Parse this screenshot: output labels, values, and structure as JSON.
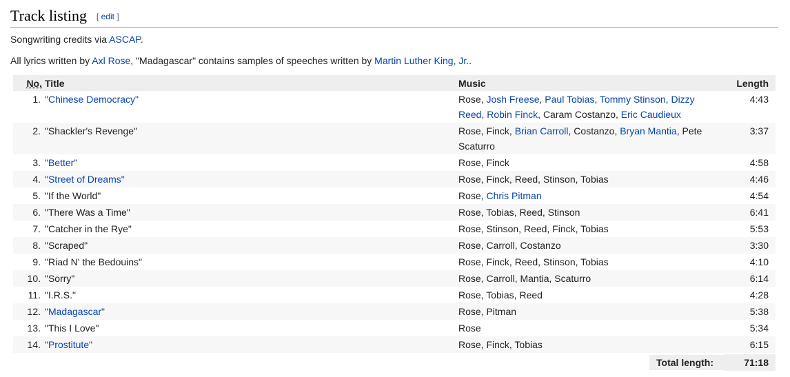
{
  "section": {
    "title": "Track listing",
    "edit_open": "[",
    "edit_label": "edit",
    "edit_close": "]"
  },
  "credits": {
    "prefix": "Songwriting credits via ",
    "link": "ASCAP",
    "suffix": "."
  },
  "lyrics": {
    "prefix": "All lyrics written by ",
    "author_link": "Axl Rose",
    "middle": ", \"Madagascar\" contains samples of speeches written by ",
    "speech_link": "Martin Luther King, Jr.",
    "suffix": "."
  },
  "table": {
    "headers": {
      "no": "No.",
      "title": "Title",
      "music": "Music",
      "length": "Length"
    },
    "rows": [
      {
        "no": "1.",
        "title": "\"Chinese Democracy\"",
        "title_link": true,
        "length": "4:43",
        "music": [
          {
            "t": "Rose, "
          },
          {
            "t": "Josh Freese",
            "link": true
          },
          {
            "t": ", "
          },
          {
            "t": "Paul Tobias",
            "link": true
          },
          {
            "t": ", "
          },
          {
            "t": "Tommy Stinson",
            "link": true
          },
          {
            "t": ", "
          },
          {
            "t": "Dizzy Reed",
            "link": true
          },
          {
            "t": ", "
          },
          {
            "t": "Robin Finck",
            "link": true
          },
          {
            "t": ", Caram Costanzo, "
          },
          {
            "t": "Eric Caudieux",
            "link": true
          }
        ]
      },
      {
        "no": "2.",
        "title": "\"Shackler's Revenge\"",
        "title_link": false,
        "length": "3:37",
        "music": [
          {
            "t": "Rose, Finck, "
          },
          {
            "t": "Brian Carroll",
            "link": true
          },
          {
            "t": ", Costanzo, "
          },
          {
            "t": "Bryan Mantia",
            "link": true
          },
          {
            "t": ", Pete Scaturro"
          }
        ]
      },
      {
        "no": "3.",
        "title": "\"Better\"",
        "title_link": true,
        "length": "4:58",
        "music": [
          {
            "t": "Rose, Finck"
          }
        ]
      },
      {
        "no": "4.",
        "title": "\"Street of Dreams\"",
        "title_link": true,
        "length": "4:46",
        "music": [
          {
            "t": "Rose, Finck, Reed, Stinson, Tobias"
          }
        ]
      },
      {
        "no": "5.",
        "title": "\"If the World\"",
        "title_link": false,
        "length": "4:54",
        "music": [
          {
            "t": "Rose, "
          },
          {
            "t": "Chris Pitman",
            "link": true
          }
        ]
      },
      {
        "no": "6.",
        "title": "\"There Was a Time\"",
        "title_link": false,
        "length": "6:41",
        "music": [
          {
            "t": "Rose, Tobias, Reed, Stinson"
          }
        ]
      },
      {
        "no": "7.",
        "title": "\"Catcher in the Rye\"",
        "title_link": false,
        "length": "5:53",
        "music": [
          {
            "t": "Rose, Stinson, Reed, Finck, Tobias"
          }
        ]
      },
      {
        "no": "8.",
        "title": "\"Scraped\"",
        "title_link": false,
        "length": "3:30",
        "music": [
          {
            "t": "Rose, Carroll, Costanzo"
          }
        ]
      },
      {
        "no": "9.",
        "title": "\"Riad N' the Bedouins\"",
        "title_link": false,
        "length": "4:10",
        "music": [
          {
            "t": "Rose, Finck, Reed, Stinson, Tobias"
          }
        ]
      },
      {
        "no": "10.",
        "title": "\"Sorry\"",
        "title_link": false,
        "length": "6:14",
        "music": [
          {
            "t": "Rose, Carroll, Mantia, Scaturro"
          }
        ]
      },
      {
        "no": "11.",
        "title": "\"I.R.S.\"",
        "title_link": false,
        "length": "4:28",
        "music": [
          {
            "t": "Rose, Tobias, Reed"
          }
        ]
      },
      {
        "no": "12.",
        "title": "\"Madagascar\"",
        "title_link": true,
        "length": "5:38",
        "music": [
          {
            "t": "Rose, Pitman"
          }
        ]
      },
      {
        "no": "13.",
        "title": "\"This I Love\"",
        "title_link": false,
        "length": "5:34",
        "music": [
          {
            "t": "Rose"
          }
        ]
      },
      {
        "no": "14.",
        "title": "\"Prostitute\"",
        "title_link": true,
        "length": "6:15",
        "music": [
          {
            "t": "Rose, Finck, Tobias"
          }
        ]
      }
    ],
    "total_label": "Total length:",
    "total_value": "71:18"
  },
  "colors": {
    "link": "#0645ad",
    "header_bg": "#eeeeee",
    "alt_row_bg": "#f7f7f7"
  }
}
